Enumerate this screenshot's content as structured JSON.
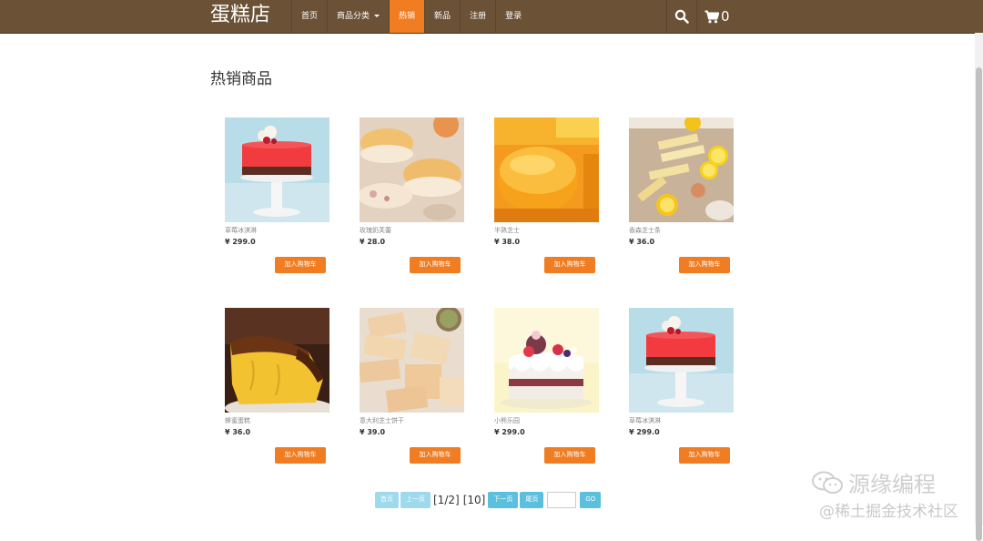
{
  "nav": {
    "brand": "蛋糕店",
    "items": [
      "首页",
      "商品分类",
      "热销",
      "新品",
      "注册",
      "登录"
    ],
    "cart_count": "0",
    "accent_color": "#f07d22",
    "bar_color": "#6b5237"
  },
  "page": {
    "title": "热销商品"
  },
  "products": [
    {
      "name": "草莓冰淇淋",
      "price": "¥ 299.0",
      "button": "加入购物车",
      "image": "strawberry-mousse-cake"
    },
    {
      "name": "玫瑰奶芙蕾",
      "price": "¥ 28.0",
      "button": "加入购物车",
      "image": "souffle-buns"
    },
    {
      "name": "半熟芝士",
      "price": "¥ 38.0",
      "button": "加入购物车",
      "image": "half-baked-cheesecake"
    },
    {
      "name": "香森芝士条",
      "price": "¥ 36.0",
      "button": "加入购物车",
      "image": "lemon-cheese-bars"
    },
    {
      "name": "蜂蜜蛋糕",
      "price": "¥ 36.0",
      "button": "加入购物车",
      "image": "chocolate-sponge-cake"
    },
    {
      "name": "意大利芝士饼干",
      "price": "¥ 39.0",
      "button": "加入购物车",
      "image": "cheese-biscuits"
    },
    {
      "name": "小熊乐园",
      "price": "¥ 299.0",
      "button": "加入购物车",
      "image": "berry-cream-cake"
    },
    {
      "name": "草莓冰淇淋",
      "price": "¥ 299.0",
      "button": "加入购物车",
      "image": "strawberry-mousse-cake"
    }
  ],
  "pagination": {
    "first": "首页",
    "prev": "上一页",
    "current": "[1/2]",
    "total": "[10]",
    "next": "下一页",
    "last": "尾页",
    "go": "GO"
  },
  "watermark": {
    "line1": "源缘编程",
    "line2": "@稀土掘金技术社区"
  }
}
